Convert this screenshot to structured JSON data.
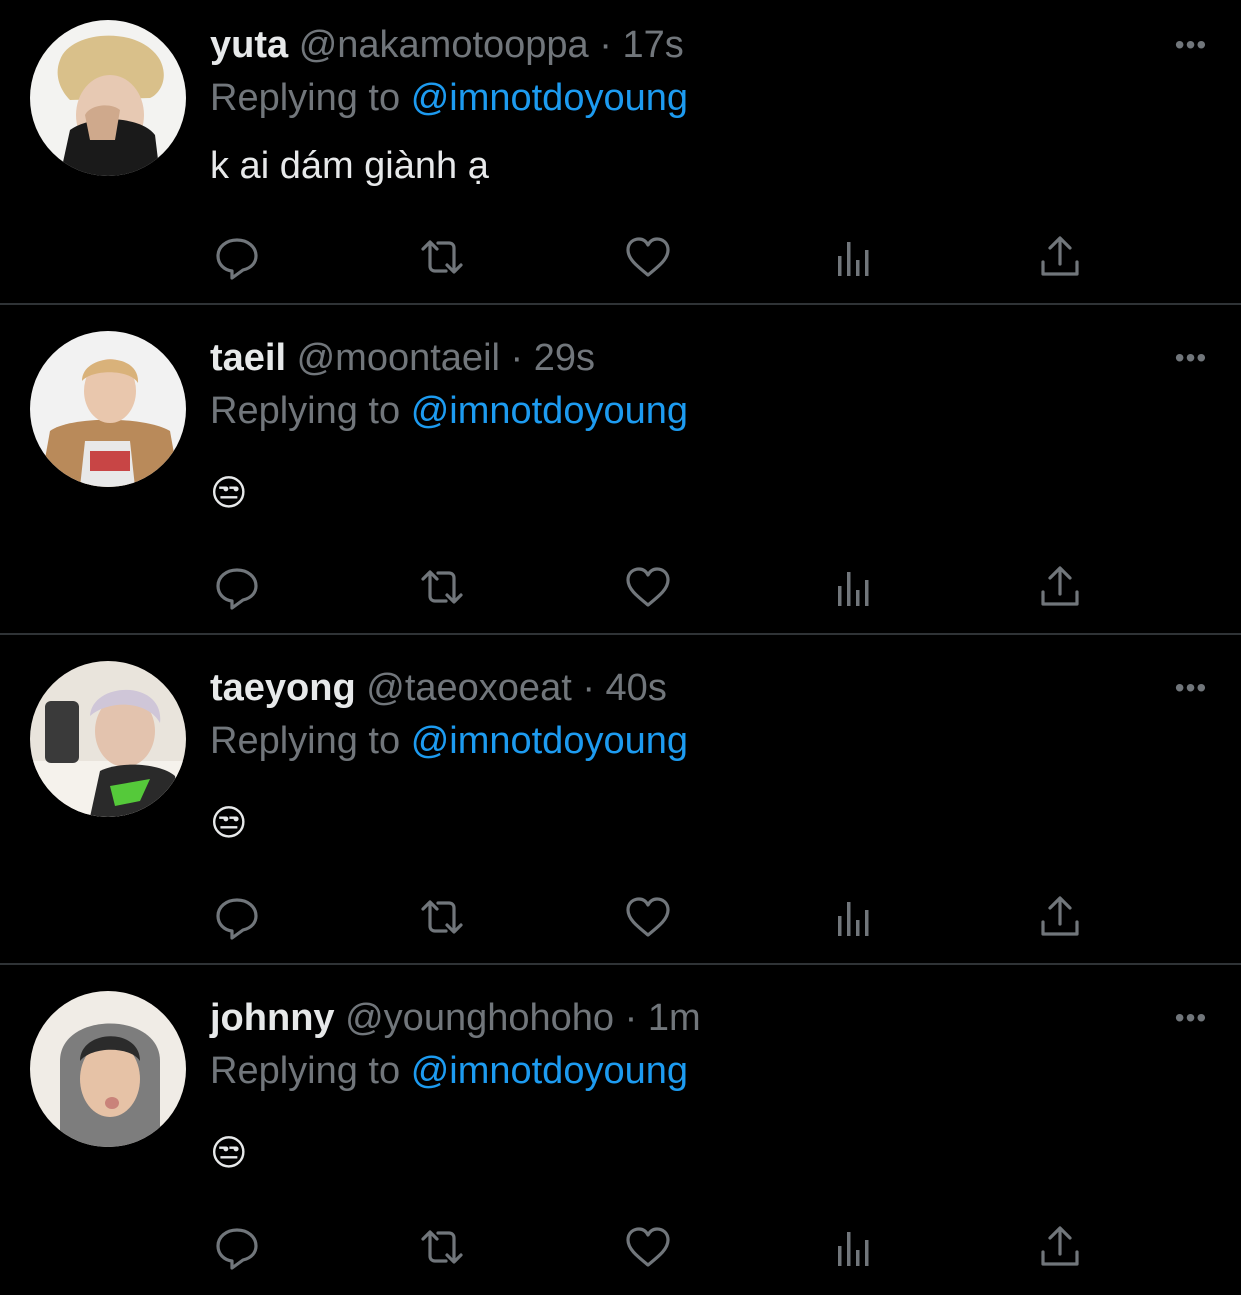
{
  "colors": {
    "background": "#000000",
    "primary_text": "#e7e9ea",
    "secondary_text": "#71767b",
    "mention": "#1d9bf0",
    "divider": "#2f3336"
  },
  "tweets": [
    {
      "display_name": "yuta",
      "handle": "@nakamotooppa",
      "separator": "·",
      "time": "17s",
      "replying_prefix": "Replying to",
      "replying_to": "@imnotdoyoung",
      "text": "k ai dám giành ạ",
      "more": "•••"
    },
    {
      "display_name": "taeil",
      "handle": "@moontaeil",
      "separator": "·",
      "time": "29s",
      "replying_prefix": "Replying to",
      "replying_to": "@imnotdoyoung",
      "text": "😒",
      "more": "•••"
    },
    {
      "display_name": "taeyong",
      "handle": "@taeoxoeat",
      "separator": "·",
      "time": "40s",
      "replying_prefix": "Replying to",
      "replying_to": "@imnotdoyoung",
      "text": "😒",
      "more": "•••"
    },
    {
      "display_name": "johnny",
      "handle": "@younghohoho",
      "separator": "·",
      "time": "1m",
      "replying_prefix": "Replying to",
      "replying_to": "@imnotdoyoung",
      "text": "😒",
      "more": "•••"
    }
  ],
  "action_icons": [
    "reply-icon",
    "retweet-icon",
    "like-icon",
    "views-icon",
    "share-icon"
  ]
}
